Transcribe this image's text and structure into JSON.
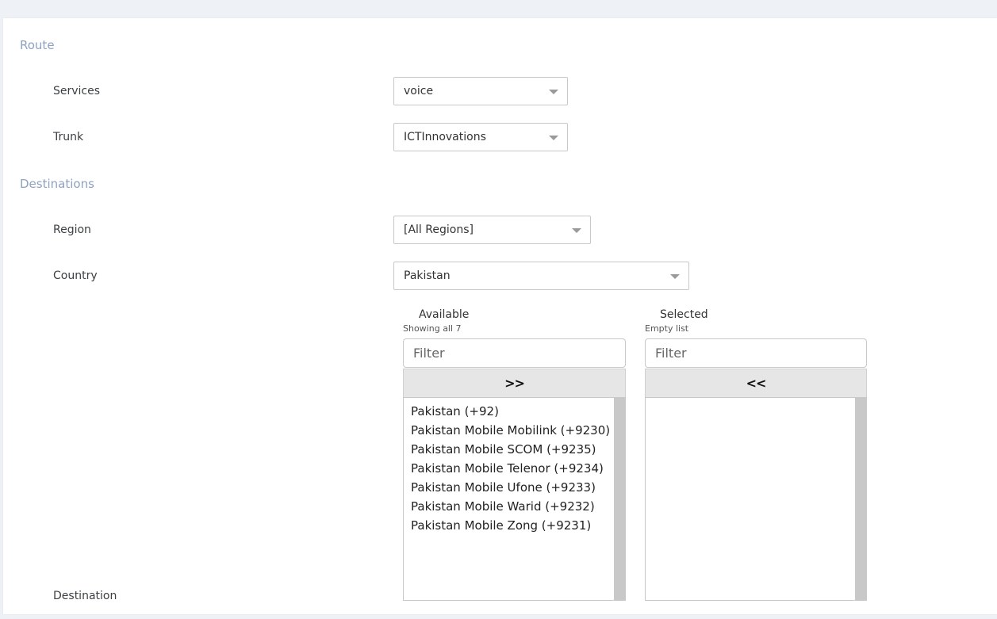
{
  "route": {
    "title": "Route",
    "services": {
      "label": "Services",
      "value": "voice"
    },
    "trunk": {
      "label": "Trunk",
      "value": "ICTInnovations"
    }
  },
  "destinations": {
    "title": "Destinations",
    "region": {
      "label": "Region",
      "value": "[All Regions]"
    },
    "country": {
      "label": "Country",
      "value": "Pakistan"
    },
    "destination_label": "Destination",
    "available": {
      "title": "Available",
      "info": "Showing all 7",
      "filter_placeholder": "Filter",
      "move_all_label": ">>",
      "options": [
        "Pakistan (+92)",
        "Pakistan Mobile Mobilink (+9230)",
        "Pakistan Mobile SCOM (+9235)",
        "Pakistan Mobile Telenor (+9234)",
        "Pakistan Mobile Ufone (+9233)",
        "Pakistan Mobile Warid (+9232)",
        "Pakistan Mobile Zong (+9231)"
      ]
    },
    "selected": {
      "title": "Selected",
      "info": "Empty list",
      "filter_placeholder": "Filter",
      "remove_all_label": "<<",
      "options": []
    }
  },
  "colors": {
    "section_title": "#8da2c0",
    "page_bg": "#eef2f6",
    "button_bg": "#e6e6e6",
    "scrollbar": "#c8c8c8"
  }
}
